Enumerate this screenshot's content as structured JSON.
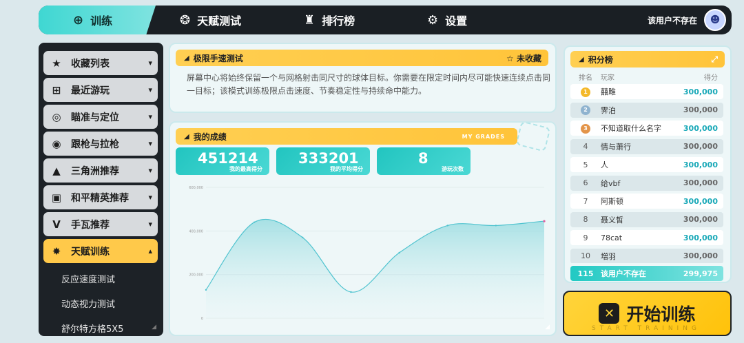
{
  "topnav": {
    "tabs": [
      {
        "label": "训练",
        "icon": "crosshair-icon"
      },
      {
        "label": "天赋测试",
        "icon": "radar-icon"
      },
      {
        "label": "排行榜",
        "icon": "podium-icon"
      },
      {
        "label": "设置",
        "icon": "gear-icon"
      }
    ],
    "username": "该用户不存在"
  },
  "sidebar": {
    "items": [
      {
        "label": "收藏列表",
        "icon": "star-icon"
      },
      {
        "label": "最近游玩",
        "icon": "gamepad-icon"
      },
      {
        "label": "瞄准与定位",
        "icon": "target-icon"
      },
      {
        "label": "跟枪与拉枪",
        "icon": "tracking-icon"
      },
      {
        "label": "三角洲推荐",
        "icon": "delta-icon"
      },
      {
        "label": "和平精英推荐",
        "icon": "console-icon"
      },
      {
        "label": "手瓦推荐",
        "icon": "valorant-icon"
      },
      {
        "label": "天赋训练",
        "icon": "spark-icon"
      }
    ],
    "subitems": [
      "反应速度测试",
      "动态视力测试",
      "舒尔特方格5X5"
    ]
  },
  "info": {
    "title": "极限手速测试",
    "fav_label": "未收藏",
    "description": "屏幕中心将始终保留一个与网格射击同尺寸的球体目标。你需要在限定时间内尽可能快速连续点击同一目标；该模式训练极限点击速度、节奏稳定性与持续命中能力。"
  },
  "grades": {
    "title": "我的成绩",
    "title_en": "MY GRADES",
    "stats": [
      {
        "value": "451214",
        "label": "我的最高得分"
      },
      {
        "value": "333201",
        "label": "我的平均得分"
      },
      {
        "value": "8",
        "label": "游玩次数"
      }
    ]
  },
  "chart_data": {
    "type": "line",
    "x": [
      1,
      2,
      3,
      4,
      5,
      6,
      7,
      8
    ],
    "values": [
      130000,
      440000,
      370000,
      120000,
      300000,
      425000,
      425000,
      445000
    ],
    "ylim": [
      0,
      600000
    ],
    "yticks": [
      "600,000",
      "400,000",
      "200,000",
      "0"
    ],
    "grid": true,
    "line_color": "#4fc3cf"
  },
  "leaderboard": {
    "title": "积分榜",
    "headers": {
      "rank": "排名",
      "player": "玩家",
      "score": "得分"
    },
    "rows": [
      {
        "rank": "1",
        "name": "囍雎",
        "score": "300,000"
      },
      {
        "rank": "2",
        "name": "霁泊",
        "score": "300,000"
      },
      {
        "rank": "3",
        "name": "不知道取什么名字",
        "score": "300,000"
      },
      {
        "rank": "4",
        "name": "情与萧行",
        "score": "300,000"
      },
      {
        "rank": "5",
        "name": "人",
        "score": "300,000"
      },
      {
        "rank": "6",
        "name": "给vbf",
        "score": "300,000"
      },
      {
        "rank": "7",
        "name": "阿斯顿",
        "score": "300,000"
      },
      {
        "rank": "8",
        "name": "聂义皙",
        "score": "300,000"
      },
      {
        "rank": "9",
        "name": "78cat",
        "score": "300,000"
      },
      {
        "rank": "10",
        "name": "増羽",
        "score": "300,000"
      }
    ],
    "me": {
      "rank": "115",
      "name": "该用户不存在",
      "score": "299,975"
    }
  },
  "start_button": {
    "label": "开始训练",
    "sub": "START TRAINING"
  }
}
